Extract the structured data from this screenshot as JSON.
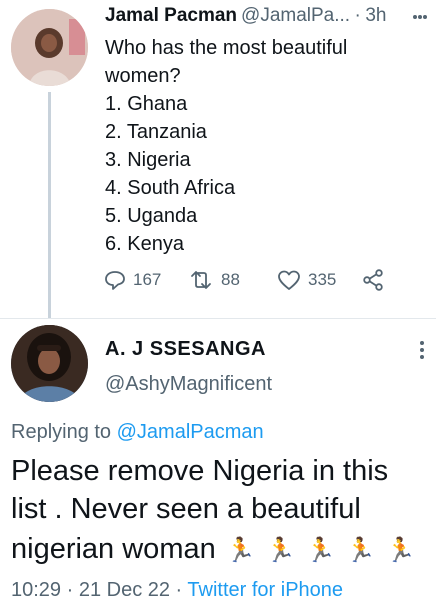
{
  "parent_tweet": {
    "author_name": "Jamal Pacman",
    "author_handle": "@JamalPa...",
    "separator": "·",
    "time": "3h",
    "text_lines": [
      "Who has the most beautiful",
      "women?",
      "1. Ghana",
      "2. Tanzania",
      "3. Nigeria",
      "4. South Africa",
      "5. Uganda",
      "6. Kenya"
    ],
    "replies": "167",
    "retweets": "88",
    "likes": "335",
    "icons": [
      "reply-icon",
      "retweet-icon",
      "like-icon",
      "share-icon",
      "more-icon"
    ]
  },
  "reply_tweet": {
    "author_name": "A. J SSESANGA",
    "author_handle": "@AshyMagnificent",
    "replying_prefix": "Replying to ",
    "replying_to": "@JamalPacman",
    "text_lines": [
      "Please remove Nigeria in this",
      "list . Never seen a beautiful",
      "nigerian woman"
    ],
    "emoji": "🏃",
    "emoji_count": 5,
    "timestamp": "10:29 · 21 Dec 22 · ",
    "source": "Twitter for iPhone"
  },
  "colors": {
    "text": "#0f1419",
    "secondary": "#536471",
    "link": "#1d9bf0",
    "thread_line": "#c8d2db"
  }
}
